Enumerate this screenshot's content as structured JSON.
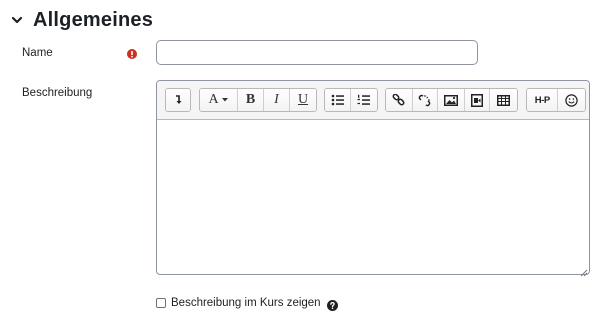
{
  "section": {
    "title": "Allgemeines",
    "toggle_icon": "chevron-down-icon"
  },
  "name_field": {
    "label": "Name",
    "value": "",
    "required_icon": "exclamation-circle-icon",
    "required_color": "#ca3120"
  },
  "description_field": {
    "label": "Beschreibung",
    "content": "",
    "toolbar": [
      {
        "group": "collapse",
        "buttons": [
          "collapse-toggle-icon"
        ]
      },
      {
        "group": "style",
        "buttons": [
          {
            "icon": "font-style-icon",
            "text": "A"
          },
          {
            "icon": "bold-icon",
            "text": "B"
          },
          {
            "icon": "italic-icon",
            "text": "I"
          },
          {
            "icon": "underline-icon",
            "text": "U"
          }
        ]
      },
      {
        "group": "list",
        "buttons": [
          "unordered-list-icon",
          "ordered-list-icon"
        ]
      },
      {
        "group": "links",
        "buttons": [
          "link-icon",
          "unlink-icon",
          "image-icon",
          "media-icon",
          "table-icon"
        ]
      },
      {
        "group": "extras",
        "buttons": [
          "h5p-icon",
          "emoji-icon"
        ]
      }
    ],
    "toolbar_text": {
      "font_letter": "A",
      "bold": "B",
      "italic": "I",
      "underline": "U",
      "h5p": "H-P"
    }
  },
  "show_description": {
    "label": "Beschreibung im Kurs zeigen",
    "checked": false,
    "help_icon": "question-circle-icon"
  },
  "colors": {
    "text": "#1d2125",
    "border": "#8f959e",
    "toolbar_bg": "#f5f5f5"
  }
}
